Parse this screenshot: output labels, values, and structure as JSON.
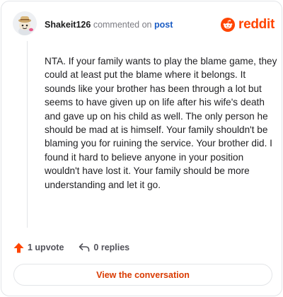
{
  "comment": {
    "username": "Shakeit126",
    "action_text": "commented on",
    "post_link": "post",
    "body": "NTA. If your family wants to play the blame game, they could at least put the blame where it belongs. It sounds like your brother has been through a lot but seems to have given up on life after his wife's death and gave up on his child as well. The only person he should be mad at is himself. Your family shouldn't be blaming you for ruining the service. Your brother did. I found it hard to believe anyone in your position wouldn't have lost it. Your family should be more understanding and let it go."
  },
  "brand": {
    "name": "reddit",
    "color": "#ff4500",
    "icon": "reddit-snoo-icon"
  },
  "actions": {
    "upvote_label": "1 upvote",
    "upvote_icon": "upvote-arrow-icon",
    "replies_label": "0 replies",
    "replies_icon": "reply-arrow-icon"
  },
  "footer": {
    "view_button_label": "View the conversation"
  }
}
